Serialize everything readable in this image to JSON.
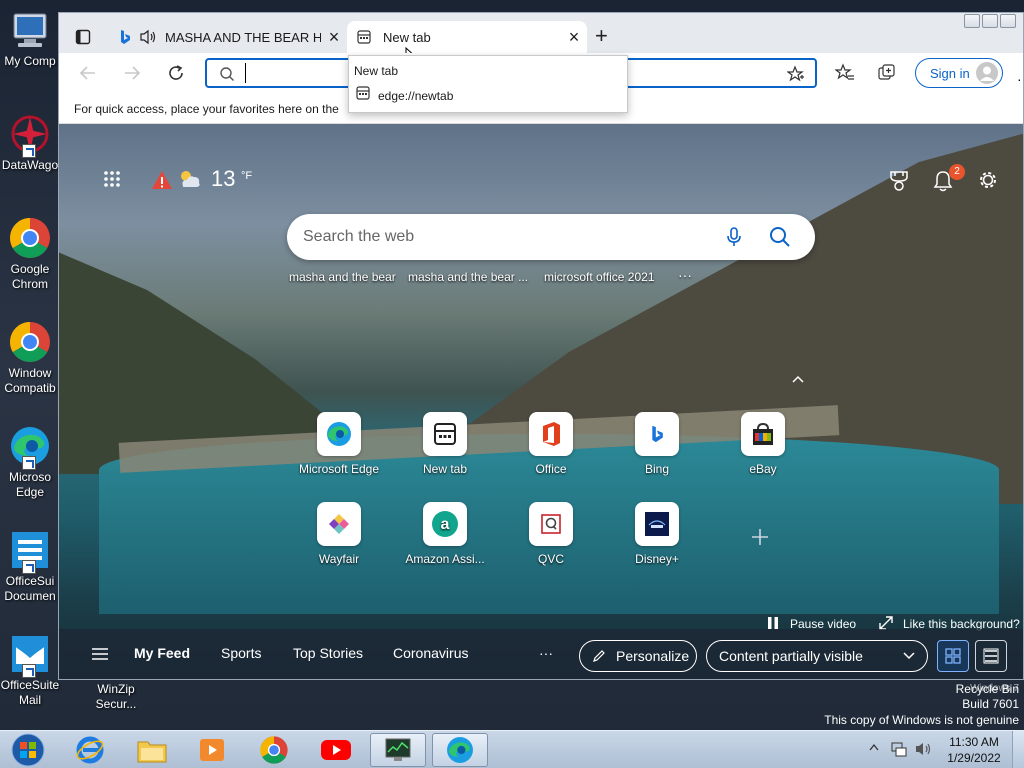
{
  "desktop": {
    "icons": [
      {
        "label": "My Comp"
      },
      {
        "label": "DataWago"
      },
      {
        "label": "Google\nChrom"
      },
      {
        "label": "Window\nCompatib"
      },
      {
        "label": "Microso\nEdge"
      },
      {
        "label": "OfficeSui\nDocumen"
      },
      {
        "label": "OfficeSuite\nMail"
      },
      {
        "label": "WinZip\nSecur..."
      },
      {
        "label": "Recycle Bin"
      }
    ],
    "watermark": {
      "line1": "Windows 7",
      "line2": "Build 7601",
      "line3": "This copy of Windows is not genuine"
    }
  },
  "browser": {
    "tabs": [
      {
        "title": "MASHA AND THE BEAR HA",
        "close": "×"
      },
      {
        "title": "New tab",
        "close": "×"
      }
    ],
    "new_tab_button": "+",
    "address": {
      "value": "",
      "placeholder": ""
    },
    "signin_label": "Sign in",
    "favorites_hint": "For quick access, place your favorites here on the",
    "dropdown": {
      "header": "New tab",
      "item": "edge://newtab"
    }
  },
  "newtab": {
    "weather": {
      "temp": "13",
      "unit": "°F"
    },
    "notifications_count": "2",
    "search_placeholder": "Search the web",
    "recent_searches": [
      "masha and the bear",
      "masha and the bear ...",
      "microsoft office 2021"
    ],
    "more": "···",
    "tiles": [
      {
        "label": "Microsoft Edge",
        "icon": "edge-icon"
      },
      {
        "label": "New tab",
        "icon": "newtab-icon"
      },
      {
        "label": "Office",
        "icon": "office-icon"
      },
      {
        "label": "Bing",
        "icon": "bing-icon"
      },
      {
        "label": "eBay",
        "icon": "ebay-icon"
      },
      {
        "label": "Wayfair",
        "icon": "wayfair-icon"
      },
      {
        "label": "Amazon Assi...",
        "icon": "amazon-icon"
      },
      {
        "label": "QVC",
        "icon": "qvc-icon"
      },
      {
        "label": "Disney+",
        "icon": "disney-icon"
      }
    ],
    "pause_video": "Pause video",
    "like_background": "Like this background?",
    "feed": {
      "items": [
        "My Feed",
        "Sports",
        "Top Stories",
        "Coronavirus"
      ],
      "more": "···",
      "personalize": "Personalize",
      "content_select": "Content partially visible"
    }
  },
  "taskbar": {
    "time": "11:30 AM",
    "date": "1/29/2022"
  },
  "colors": {
    "accent": "#0a63c9",
    "notification_badge": "#e8542c"
  }
}
